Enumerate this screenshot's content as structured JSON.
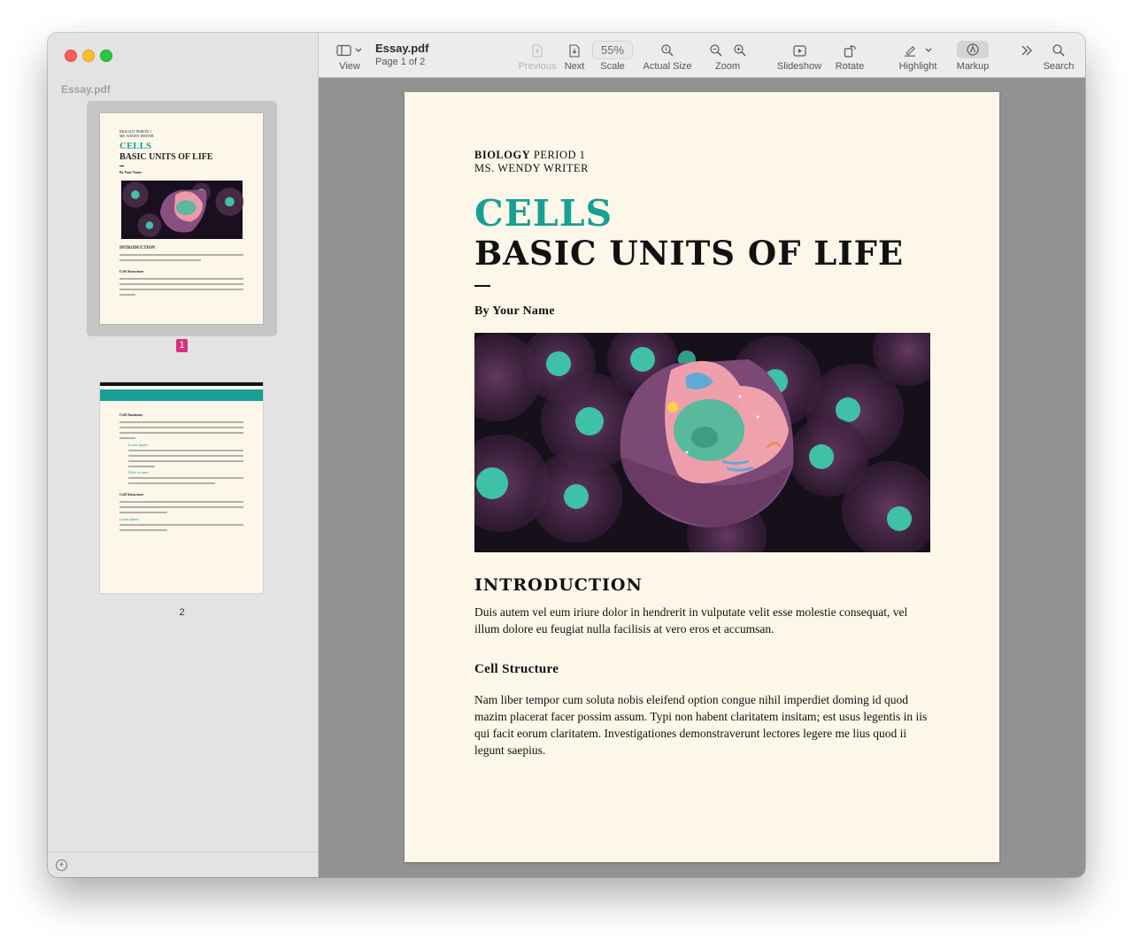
{
  "app": {
    "window_title": "Essay.pdf",
    "page_info": "Page 1 of 2"
  },
  "sidebar": {
    "title": "Essay.pdf",
    "pages": [
      {
        "label": "1",
        "selected": true
      },
      {
        "label": "2",
        "selected": false
      }
    ],
    "thumb1": {
      "class": "BIOLOGY PERIOD 1",
      "teacher": "MS. WENDY WRITER",
      "cells": "CELLS",
      "title": "BASIC UNITS OF LIFE",
      "by": "By Your Name",
      "h1": "INTRODUCTION",
      "h2": "Cell Structure"
    },
    "thumb2": {
      "h1": "Cell Anatomy",
      "item1": "Lorem ipsum",
      "item2": "Dolor sit amet",
      "h2": "Cell Structure",
      "h3": "Lorem ipsum"
    }
  },
  "toolbar": {
    "view_label": "View",
    "previous_label": "Previous",
    "next_label": "Next",
    "scale_value": "55%",
    "scale_label": "Scale",
    "actual_size_label": "Actual Size",
    "zoom_label": "Zoom",
    "slideshow_label": "Slideshow",
    "rotate_label": "Rotate",
    "highlight_label": "Highlight",
    "markup_label": "Markup",
    "search_label": "Search"
  },
  "document": {
    "class_bold": "BIOLOGY",
    "class_rest": " PERIOD 1",
    "teacher": "MS. WENDY WRITER",
    "cells": "CELLS",
    "title": "BASIC UNITS OF LIFE",
    "byline": "By Your Name",
    "intro_heading": "INTRODUCTION",
    "intro_text": "Duis autem vel eum iriure dolor in hendrerit in vulputate velit esse molestie consequat, vel illum dolore eu feugiat nulla facilisis at vero eros et accumsan.",
    "section_heading": "Cell Structure",
    "section_text": "Nam liber tempor cum soluta nobis eleifend option congue nihil imperdiet doming id quod mazim placerat facer possim assum. Typi non habent claritatem insitam; est usus legentis in iis qui facit eorum claritatem. Investigationes demonstraverunt lectores legere me lius quod ii legunt saepius."
  },
  "colors": {
    "accent_teal": "#17a093",
    "page_bg": "#fdf7ea",
    "badge": "#d8307a"
  }
}
